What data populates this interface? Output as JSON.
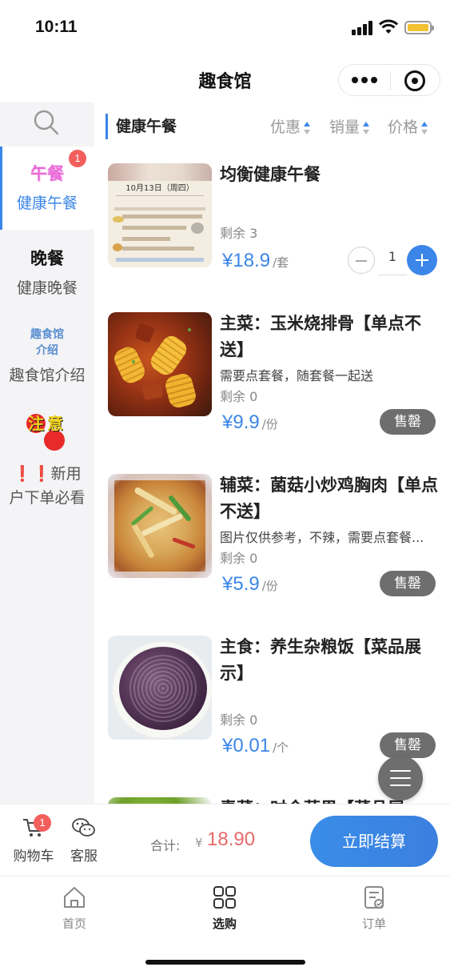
{
  "status_bar": {
    "time": "10:11"
  },
  "nav": {
    "title": "趣食馆"
  },
  "sidebar": {
    "items": [
      {
        "icon_text": "午餐",
        "label": "健康午餐",
        "badge": "1",
        "active": true
      },
      {
        "icon_text": "晚餐",
        "label": "健康晚餐"
      },
      {
        "icon_text": "趣食馆 介绍",
        "label": "趣食馆介绍"
      },
      {
        "icon_text": "注意",
        "label": "❗❗新用户下单必看"
      }
    ]
  },
  "filter": {
    "category": "健康午餐",
    "sorts": [
      "优惠",
      "销量",
      "价格"
    ]
  },
  "products": [
    {
      "name": "均衡健康午餐",
      "desc": "",
      "stock": "剩余 3",
      "price": "18.9",
      "unit": "/套",
      "qty": "1",
      "image": "menu-image"
    },
    {
      "name": "主菜：玉米烧排骨【单点不送】",
      "desc": "需要点套餐，随套餐一起送",
      "stock": "剩余 0",
      "price": "9.9",
      "unit": "/份",
      "status": "售罄",
      "image": "corn-ribs-image"
    },
    {
      "name": "辅菜：菌菇小炒鸡胸肉【单点不送】",
      "desc": "图片仅供参考，不辣，需要点套餐...",
      "stock": "剩余 0",
      "price": "5.9",
      "unit": "/份",
      "status": "售罄",
      "image": "chicken-mushroom-image"
    },
    {
      "name": "主食：养生杂粮饭【菜品展示】",
      "desc": "",
      "stock": "剩余 0",
      "price": "0.01",
      "unit": "/个",
      "status": "售罄",
      "image": "grain-rice-image"
    },
    {
      "name": "青菜：时令蔬果【菜品展",
      "image": "vegetable-image"
    }
  ],
  "menu_thumb": {
    "date": "10月13日（周四）"
  },
  "currency": "¥",
  "cart_bar": {
    "cart_label": "购物车",
    "cart_badge": "1",
    "service_label": "客服",
    "total_label": "合计:",
    "total_currency": "¥",
    "total_value": "18.90",
    "checkout_label": "立即结算"
  },
  "tabs": [
    {
      "label": "首页",
      "icon": "home-icon"
    },
    {
      "label": "选购",
      "icon": "grid-icon",
      "active": true
    },
    {
      "label": "订单",
      "icon": "order-icon"
    }
  ],
  "colors": {
    "accent": "#3b86e8",
    "price_total": "#e66a6a",
    "soldout": "#6e6e6e",
    "badge": "#f25f5c"
  }
}
